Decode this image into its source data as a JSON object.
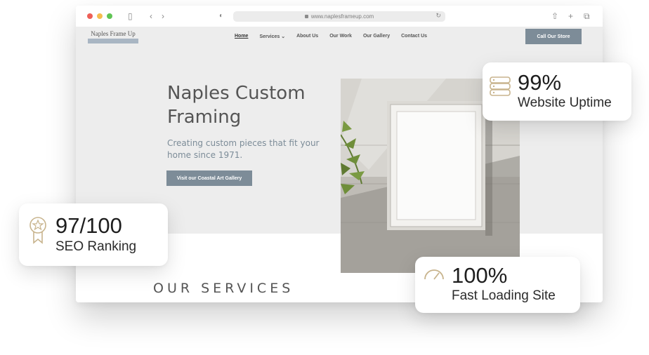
{
  "browser": {
    "url": "www.naplesframeup.com"
  },
  "site": {
    "logo": "Naples Frame Up",
    "nav": [
      "Home",
      "Services ⌄",
      "About Us",
      "Our Work",
      "Our Gallery",
      "Contact Us"
    ],
    "call_button": "Call Our Store",
    "hero_title": "Naples Custom Framing",
    "hero_subtitle": "Creating custom pieces that fit your home since 1971.",
    "gallery_button": "Visit our Coastal Art Gallery",
    "services_heading": "OUR SERVICES"
  },
  "stats": {
    "uptime": {
      "value": "99%",
      "label": "Website Uptime"
    },
    "seo": {
      "value": "97/100",
      "label": "SEO Ranking"
    },
    "speed": {
      "value": "100%",
      "label": "Fast Loading Site"
    }
  },
  "colors": {
    "accent": "#7d8c98",
    "icon_gold": "#c8b48d"
  }
}
